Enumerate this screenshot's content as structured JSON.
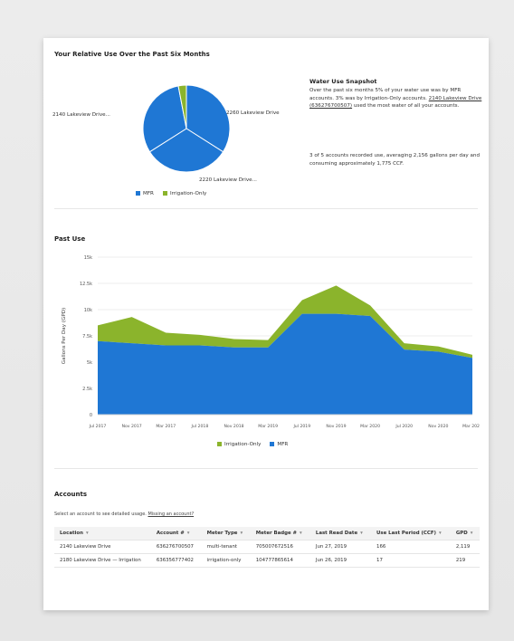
{
  "header": {
    "relative_title": "Your Relative Use Over the Past Six Months"
  },
  "pie": {
    "slices": [
      {
        "label": "2140 Lakeview Drive...",
        "value": 34,
        "color": "#1f77d4",
        "type": "MFR"
      },
      {
        "label": "2260 Lakeview Drive",
        "value": 32,
        "color": "#1f77d4",
        "type": "MFR"
      },
      {
        "label": "2220 Lakeview Drive...",
        "value": 31,
        "color": "#1f77d4",
        "type": "MFR"
      },
      {
        "label": "",
        "value": 3,
        "color": "#8bb42c",
        "type": "Irrigation-Only"
      }
    ],
    "legend": [
      {
        "name": "MFR",
        "color": "#1f77d4"
      },
      {
        "name": "Irrigation-Only",
        "color": "#8bb42c"
      }
    ]
  },
  "snapshot": {
    "title": "Water Use Snapshot",
    "text_prefix": "Over the past six months 5% of your water use was by MFR accounts. 3% was by Irrigation-Only accounts. ",
    "link_text": "2140 Lakeview Drive (636276700507)",
    "text_suffix": " used the most water of all your accounts.",
    "text2": "3 of 5 accounts recorded use, averaging 2,156 gallons per day and consuming approximately 1,775 CCF."
  },
  "chart_data": {
    "type": "area",
    "title": "Past Use",
    "ylabel": "Gallons Per Day (GPD)",
    "x": [
      "Jul 2017",
      "Nov 2017",
      "Mar 2017",
      "Jul 2018",
      "Nov 2018",
      "Mar 2019",
      "Jul 2019",
      "Nov 2019",
      "Mar 2020",
      "Jul 2020",
      "Nov 2020",
      "Mar 2021"
    ],
    "ylim": [
      0,
      15
    ],
    "yticks": [
      "0",
      "2.5k",
      "5k",
      "7.5k",
      "10k",
      "12.5k",
      "15k"
    ],
    "series": [
      {
        "name": "MFR",
        "color": "#1f77d4",
        "values": [
          7.0,
          6.8,
          6.6,
          6.6,
          6.4,
          6.4,
          9.6,
          9.6,
          9.4,
          6.2,
          6.0,
          5.4
        ]
      },
      {
        "name": "Irrigation-Only",
        "color": "#8bb42c",
        "values": [
          1.5,
          2.5,
          1.2,
          1.0,
          0.8,
          0.7,
          1.3,
          2.7,
          1.0,
          0.6,
          0.5,
          0.3
        ]
      }
    ],
    "legend": [
      {
        "name": "Irrigation-Only",
        "color": "#8bb42c"
      },
      {
        "name": "MFR",
        "color": "#1f77d4"
      }
    ]
  },
  "accounts": {
    "title": "Accounts",
    "subtitle": "Select an account to see detailed usage.",
    "subtitle_link": "Missing an account?",
    "columns": [
      "Location",
      "Account #",
      "Meter Type",
      "Meter Badge #",
      "Last Read Date",
      "Use Last Period (CCF)",
      "GPD"
    ],
    "rows": [
      [
        "2140 Lakeview Drive",
        "636276700507",
        "multi-tenant",
        "705007672516",
        "Jun 27, 2019",
        "166",
        "2,119"
      ],
      [
        "2180 Lakeview Drive — Irrigation",
        "636356777402",
        "irrigation-only",
        "104777865614",
        "Jun 26, 2019",
        "17",
        "219"
      ]
    ]
  }
}
